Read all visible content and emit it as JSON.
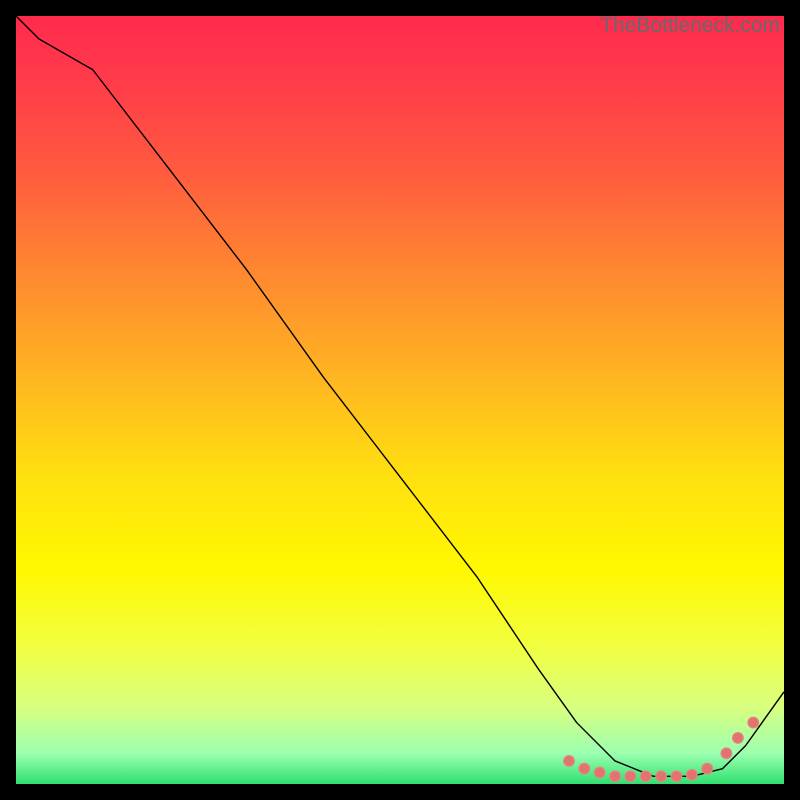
{
  "watermark": "TheBottleneck.com",
  "chart_data": {
    "type": "line",
    "title": "",
    "xlabel": "",
    "ylabel": "",
    "xlim": [
      0,
      100
    ],
    "ylim": [
      0,
      100
    ],
    "series": [
      {
        "name": "bottleneck-curve",
        "x": [
          0,
          3,
          10,
          20,
          30,
          40,
          50,
          60,
          68,
          73,
          78,
          83,
          88,
          92,
          95,
          100
        ],
        "y": [
          100,
          97,
          93,
          80,
          67,
          53,
          40,
          27,
          15,
          8,
          3,
          1,
          1,
          2,
          5,
          12
        ]
      }
    ],
    "markers": {
      "name": "data-points",
      "x": [
        72,
        74,
        76,
        78,
        80,
        82,
        84,
        86,
        88,
        90,
        92.5,
        94,
        96
      ],
      "y": [
        3,
        2,
        1.5,
        1,
        1,
        1,
        1,
        1,
        1.2,
        2,
        4,
        6,
        8
      ]
    },
    "colors": {
      "curve": "#000000",
      "marker_fill": "#e2736f",
      "marker_stroke": "#e28884"
    }
  }
}
